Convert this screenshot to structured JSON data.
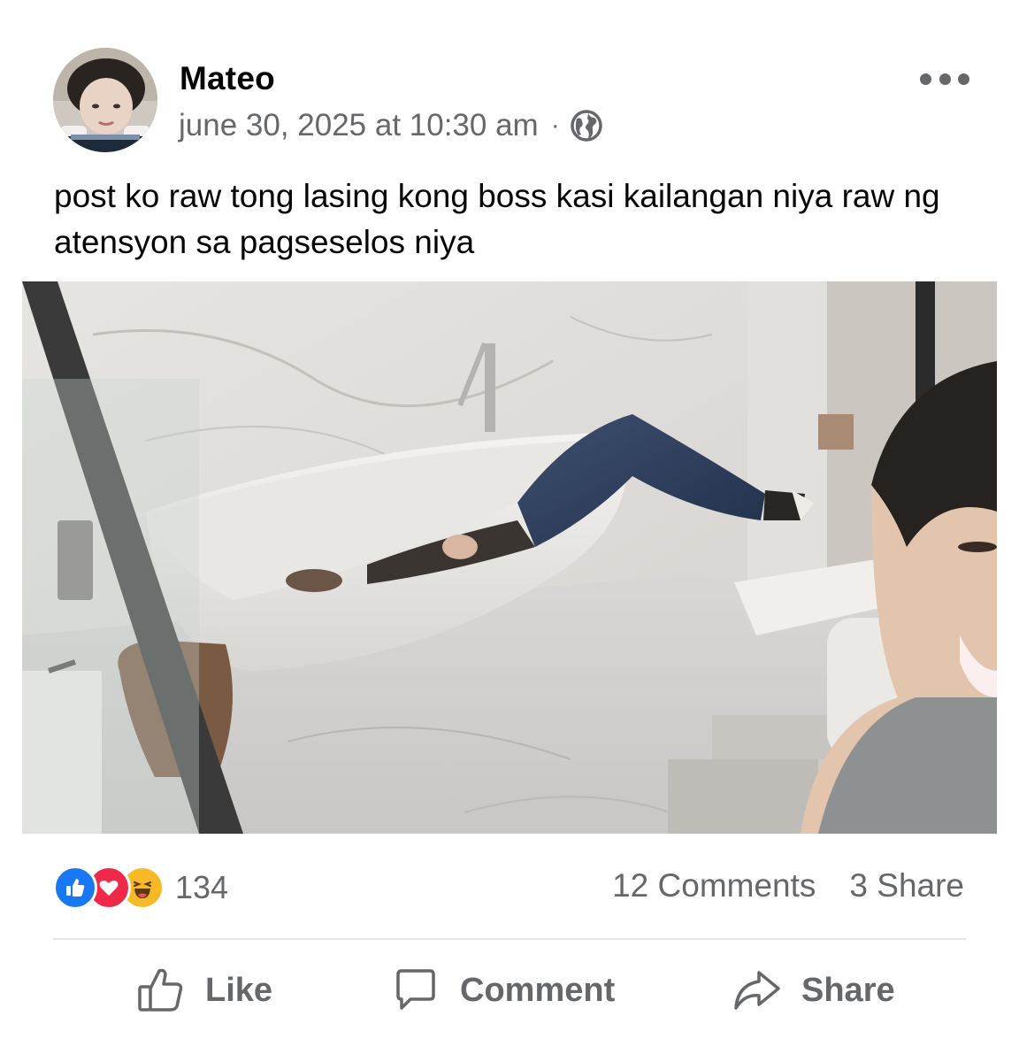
{
  "post": {
    "author": "Mateo",
    "timestamp": "june 30, 2025 at 10:30 am",
    "separator": "·",
    "audience_icon": "globe-icon",
    "text": "post ko raw tong lasing kong boss kasi kailangan niya raw ng atensyon sa pagseselos niya"
  },
  "stats": {
    "reactions": [
      "like",
      "love",
      "haha"
    ],
    "reaction_count": "134",
    "comments": "12 Comments",
    "shares": "3 Share"
  },
  "actions": {
    "like": "Like",
    "comment": "Comment",
    "share": "Share"
  },
  "colors": {
    "like_blue": "#1877f2",
    "love_red": "#f02849",
    "haha_yellow": "#f7b928",
    "secondary_text": "#65676b"
  }
}
